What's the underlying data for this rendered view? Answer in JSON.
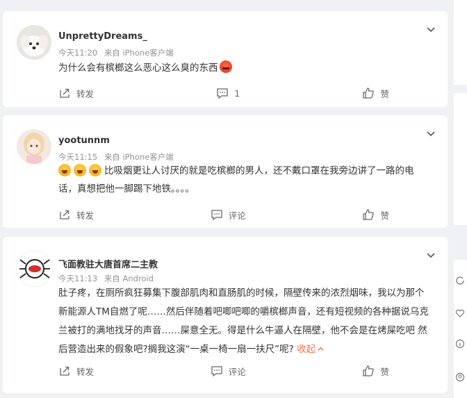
{
  "comments": [
    {
      "username": "UnprettyDreams_",
      "time": "今天11:20",
      "source": "来自 iPhone客户端",
      "text": "为什么会有槟榔这么恶心这么臭的东西",
      "repost_label": "转发",
      "comment_label": "1",
      "like_label": "赞"
    },
    {
      "username": "yootunnm",
      "time": "今天11:15",
      "source": "来自 iPhone客户端",
      "text": "比吸烟更让人讨厌的就是吃槟榔的男人，还不戴口罩在我旁边讲了一路的电话，真想把他一脚踢下地铁。。。。",
      "repost_label": "转发",
      "comment_label": "评论",
      "like_label": "赞"
    },
    {
      "username": "飞面教驻大唐首席二主教",
      "time": "今天11:13",
      "source": "来自 Android",
      "text": "肚子疼，在厕所疯狂募集下腹部肌肉和直肠肌的时候，隔壁传来的浓烈烟味，我以为那个新能源人TM自燃了呢……然后伴随着吧唧吧唧的嚼槟榔声音，还有短视频的各种据说乌克兰被打的满地找牙的声音……屎意全无。得是什么牛逼人在隔壁，他不会是在烤屎吃吧 然后营造出来的假象吧?搁我这演“一桌一椅一扇一扶尺”呢?",
      "collapse_label": "收起",
      "repost_label": "转发",
      "comment_label": "评论",
      "like_label": "赞"
    }
  ],
  "icons": {
    "chevron": "chevron-down-icon",
    "repost": "repost-icon",
    "comment": "comment-icon",
    "like": "thumbs-up-icon"
  },
  "colors": {
    "accent": "#eb7350",
    "username": "#333333",
    "meta": "#939393",
    "background": "#f0f1f4"
  }
}
